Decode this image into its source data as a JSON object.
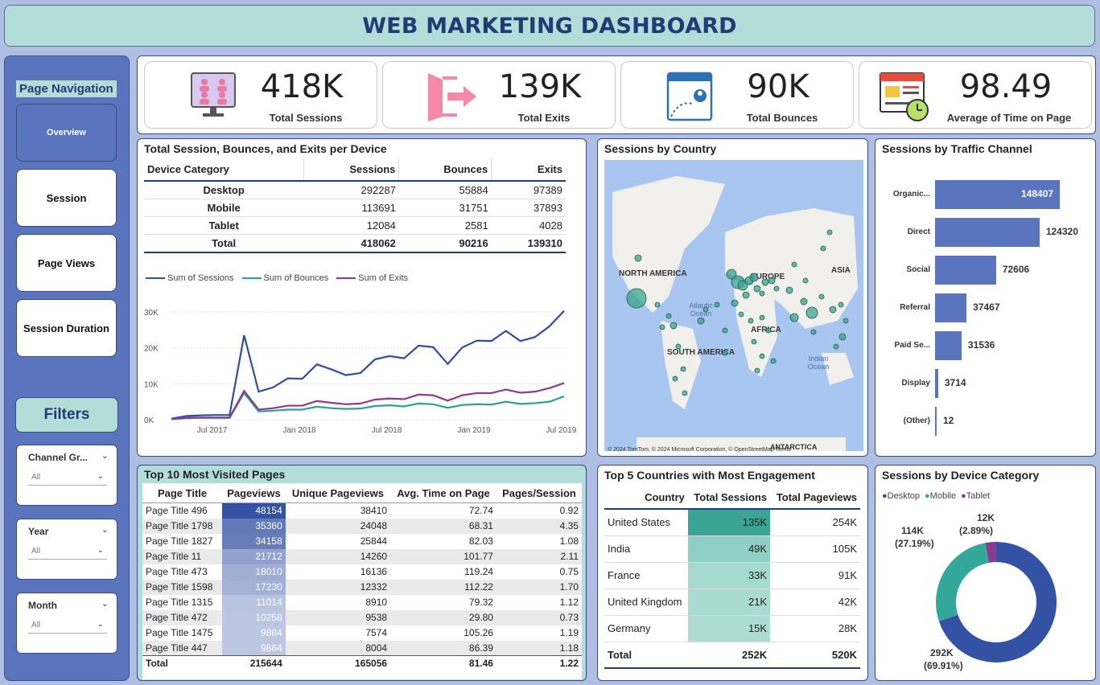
{
  "header": {
    "title": "WEB MARKETING DASHBOARD"
  },
  "sidebar": {
    "nav_title": "Page Navigation",
    "buttons": [
      "Overview",
      "Session",
      "Page Views",
      "Session Duration"
    ],
    "filters_title": "Filters",
    "slicers": [
      {
        "label": "Channel Gr...",
        "value": "All"
      },
      {
        "label": "Year",
        "value": "All"
      },
      {
        "label": "Month",
        "value": "All"
      }
    ]
  },
  "kpis": [
    {
      "value": "418K",
      "caption": "Total Sessions"
    },
    {
      "value": "139K",
      "caption": "Total Exits"
    },
    {
      "value": "90K",
      "caption": "Total Bounces"
    },
    {
      "value": "98.49",
      "caption": "Average of Time on Page"
    }
  ],
  "device_panel": {
    "title": "Total Session, Bounces, and Exits per Device",
    "columns": [
      "Device Category",
      "Sessions",
      "Bounces",
      "Exits"
    ],
    "rows": [
      [
        "Desktop",
        "292287",
        "55884",
        "97389"
      ],
      [
        "Mobile",
        "113691",
        "31751",
        "37893"
      ],
      [
        "Tablet",
        "12084",
        "2581",
        "4028"
      ]
    ],
    "total": [
      "Total",
      "418062",
      "90216",
      "139310"
    ],
    "legend": [
      "Sum of Sessions",
      "Sum of Bounces",
      "Sum of Exits"
    ]
  },
  "chart_data": {
    "type": "line",
    "x_ticks": [
      "Jul 2017",
      "Jan 2018",
      "Jul 2018",
      "Jan 2019",
      "Jul 2019"
    ],
    "y_ticks": [
      "0K",
      "10K",
      "20K",
      "30K"
    ],
    "ylim": [
      0,
      32000
    ],
    "series": [
      {
        "name": "Sum of Sessions",
        "color": "#2f4f9a",
        "values": [
          300,
          1000,
          1200,
          1300,
          1300,
          23500,
          7800,
          9000,
          11500,
          11400,
          15400,
          14000,
          12400,
          13000,
          16800,
          17700,
          17100,
          20600,
          20200,
          15500,
          20100,
          22000,
          21900,
          24700,
          21900,
          23000,
          26000,
          30300
        ]
      },
      {
        "name": "Sum of Bounces",
        "color": "#2ea38a",
        "values": [
          100,
          400,
          500,
          500,
          500,
          7400,
          2300,
          2500,
          2800,
          2800,
          3600,
          3200,
          3000,
          3100,
          3800,
          4000,
          3700,
          4500,
          4300,
          3300,
          4100,
          4300,
          4200,
          5000,
          4400,
          4600,
          5000,
          6500
        ]
      },
      {
        "name": "Sum of Exits",
        "color": "#8b3a91",
        "values": [
          200,
          500,
          600,
          600,
          600,
          8000,
          2800,
          3200,
          3900,
          3900,
          5200,
          4700,
          4300,
          4500,
          5600,
          5900,
          5700,
          7000,
          6800,
          5300,
          6800,
          7400,
          7400,
          8400,
          7500,
          7800,
          8800,
          10200
        ]
      }
    ]
  },
  "map_panel": {
    "title": "Sessions by Country",
    "labels": [
      "NORTH AMERICA",
      "EUROPE",
      "ASIA",
      "AFRICA",
      "SOUTH AMERICA",
      "ANTARCTICA"
    ],
    "oceans": [
      "Atlantic Ocean",
      "Indian Ocean"
    ],
    "footer": "© 2024 TomTom, © 2024 Microsoft Corporation, © OpenStreetMap Terms"
  },
  "channel_panel": {
    "title": "Sessions by Traffic Channel",
    "chart_data": {
      "type": "bar",
      "categories": [
        "Organic...",
        "Direct",
        "Social",
        "Referral",
        "Paid Se...",
        "Display",
        "(Other)"
      ],
      "values": [
        148407,
        124320,
        72606,
        37467,
        31536,
        3714,
        12
      ]
    }
  },
  "pages_panel": {
    "title": "Top 10 Most Visited Pages",
    "columns": [
      "Page Title",
      "Pageviews",
      "Unique Pageviews",
      "Avg. Time on Page",
      "Pages/Session"
    ],
    "rows": [
      [
        "Page Title 496",
        "48154",
        "38410",
        "72.74",
        "0.92"
      ],
      [
        "Page Title 1798",
        "35360",
        "24048",
        "68.31",
        "4.35"
      ],
      [
        "Page Title 1827",
        "34158",
        "25844",
        "82.03",
        "1.08"
      ],
      [
        "Page Title 11",
        "21712",
        "14260",
        "101.77",
        "2.11"
      ],
      [
        "Page Title 473",
        "18010",
        "16136",
        "119.24",
        "0.75"
      ],
      [
        "Page Title 1598",
        "17230",
        "12332",
        "112.22",
        "1.70"
      ],
      [
        "Page Title 1315",
        "11014",
        "8910",
        "79.32",
        "1.12"
      ],
      [
        "Page Title 472",
        "10258",
        "9538",
        "29.80",
        "0.73"
      ],
      [
        "Page Title 1475",
        "9884",
        "7574",
        "105.26",
        "1.19"
      ],
      [
        "Page Title 447",
        "9864",
        "8004",
        "86.39",
        "1.18"
      ]
    ],
    "total": [
      "Total",
      "215644",
      "165056",
      "81.46",
      "1.22"
    ]
  },
  "countries_panel": {
    "title": "Top 5 Countries with Most Engagement",
    "columns": [
      "Country",
      "Total Sessions",
      "Total Pageviews"
    ],
    "rows": [
      [
        "United States",
        "135K",
        "254K"
      ],
      [
        "India",
        "49K",
        "105K"
      ],
      [
        "France",
        "33K",
        "91K"
      ],
      [
        "United Kingdom",
        "21K",
        "42K"
      ],
      [
        "Germany",
        "15K",
        "28K"
      ]
    ],
    "total": [
      "Total",
      "252K",
      "520K"
    ]
  },
  "device_donut": {
    "title": "Sessions by Device Category",
    "legend": [
      "Desktop",
      "Mobile",
      "Tablet"
    ],
    "colors": [
      "#3452a3",
      "#33a89a",
      "#8b3a91"
    ],
    "chart_data": {
      "type": "pie",
      "categories": [
        "Desktop",
        "Mobile",
        "Tablet"
      ],
      "values": [
        292287,
        113691,
        12084
      ]
    },
    "labels": {
      "desktop_val": "292K",
      "desktop_pct": "(69.91%)",
      "mobile_val": "114K",
      "mobile_pct": "(27.19%)",
      "tablet_val": "12K",
      "tablet_pct": "(2.89%)"
    }
  }
}
